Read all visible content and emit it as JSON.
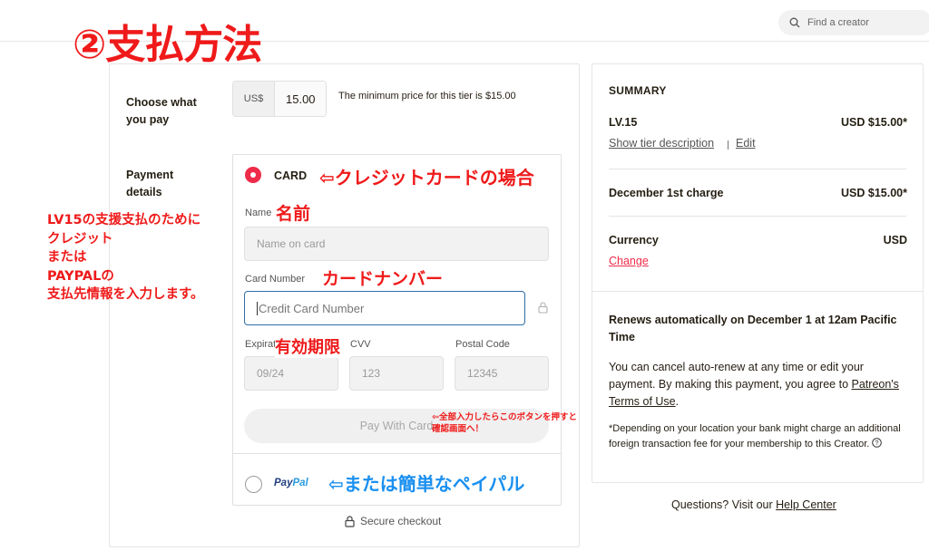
{
  "header": {
    "search_placeholder": "Find a creator"
  },
  "annotations": {
    "title": "②支払方法",
    "card_case": "⇦クレジットカードの場合",
    "name": "名前",
    "card_number": "カードナンバー",
    "expiry": "有効期限",
    "button_hint_line1": "⇦全部入力したらこのボタンを押すと",
    "button_hint_line2": "確認画面へ！",
    "paypal_hint": "⇦または簡単なペイパル",
    "left_note": [
      "LV15の支援支払のために",
      "クレジット",
      "または",
      "PAYPALの",
      "支払先情報を入力します。"
    ]
  },
  "checkout": {
    "choose_label": "Choose what you pay",
    "currency": "US$",
    "price_value": "15.00",
    "min_note": "The minimum price for this tier is $15.00",
    "payment_label": "Payment details",
    "card_option": "CARD",
    "name_label": "Name",
    "name_placeholder": "Name on card",
    "card_number_label": "Card Number",
    "card_number_placeholder": "Credit Card Number",
    "expiry_label": "Expiration",
    "expiry_placeholder": "09/24",
    "cvv_label": "CVV",
    "cvv_placeholder": "123",
    "postal_label": "Postal Code",
    "postal_placeholder": "12345",
    "pay_button": "Pay With Card",
    "paypal_part1": "Pay",
    "paypal_part2": "Pal",
    "secure_checkout": "Secure checkout"
  },
  "summary": {
    "title": "SUMMARY",
    "tier_name": "LV.15",
    "tier_price": "USD $15.00*",
    "show_tier": "Show tier description",
    "edit": "Edit",
    "charge_label": "December 1st charge",
    "charge_price": "USD $15.00*",
    "currency_label": "Currency",
    "currency_value": "USD",
    "change": "Change",
    "renews": "Renews automatically on December 1 at 12am Pacific Time",
    "cancel_text": "You can cancel auto-renew at any time or edit your payment. By making this payment, you agree to",
    "terms_link": "Patreon's Terms of Use",
    "terms_period": ".",
    "disclaimer": "*Depending on your location your bank might charge an additional foreign transaction fee for your membership to this Creator.",
    "questions_text": "Questions? Visit our",
    "help_center": "Help Center"
  },
  "colors": {
    "accent": "#ef2b4a",
    "annotation_red": "#ef1a1a",
    "annotation_blue": "#1a90f0",
    "input_focus": "#2c6ea8"
  }
}
